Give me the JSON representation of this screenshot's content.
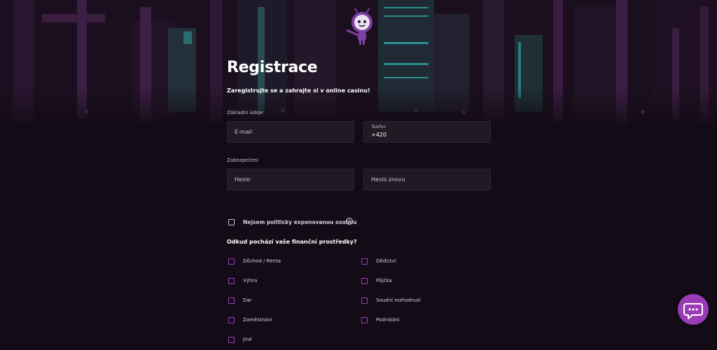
{
  "header": {
    "title": "Registrace",
    "subtitle": "Zaregistrujte se a zahrajte si v online casinu!"
  },
  "basic_section": {
    "label": "Základní údaje",
    "email_placeholder": "E-mail",
    "phone_label": "Telefon",
    "phone_value": "+420"
  },
  "security_section": {
    "label": "Zabezpečení",
    "password_placeholder": "Heslo",
    "password_again_placeholder": "Heslo znovu"
  },
  "pep": {
    "label": "Nejsem politicky exponovanou osobou",
    "help_icon": "question-circle-icon",
    "help_glyph": "?"
  },
  "funds": {
    "question": "Odkud pochází vaše finanční prostředky?",
    "left_options": [
      "Důchod / Renta",
      "Výhra",
      "Dar",
      "Zaměstnání",
      "Jiné"
    ],
    "right_options": [
      "Dědictví",
      "Půjčka",
      "Soudní rozhodnutí",
      "Podnikání"
    ]
  },
  "chat": {
    "icon": "chat-bubble-icon"
  },
  "colors": {
    "background": "#130b15",
    "field": "#211a24",
    "accent": "#9b3cb7",
    "checkbox_border": "#9a3fc0"
  }
}
